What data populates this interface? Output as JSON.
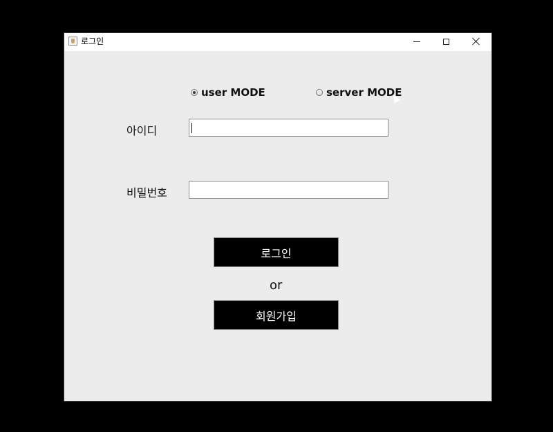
{
  "window": {
    "title": "로그인"
  },
  "mode": {
    "user_label": "user MODE",
    "server_label": "server MODE",
    "selected": "user MODE"
  },
  "form": {
    "id_label": "아이디",
    "id_value": "",
    "password_label": "비밀번호",
    "password_value": ""
  },
  "actions": {
    "login_label": "로그인",
    "or_text": "or",
    "signup_label": "회원가입"
  },
  "icons": [
    "java-app-icon",
    "minimize-icon",
    "maximize-icon",
    "close-icon",
    "mouse-cursor-icon"
  ]
}
